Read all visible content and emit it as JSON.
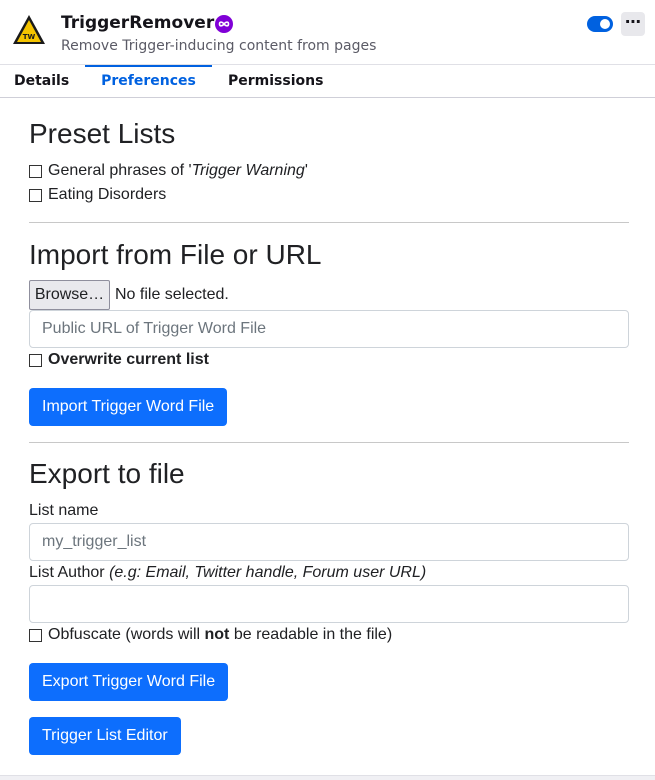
{
  "header": {
    "title": "TriggerRemover",
    "subtitle": "Remove Trigger-inducing content from pages",
    "logo_text": "TW",
    "more_label": "⋯"
  },
  "tabs": [
    {
      "label": "Details"
    },
    {
      "label": "Preferences"
    },
    {
      "label": "Permissions"
    }
  ],
  "preset": {
    "heading": "Preset Lists",
    "general_prefix": "General phrases of '",
    "general_italic": "Trigger Warning",
    "general_suffix": "'",
    "eating": "Eating Disorders"
  },
  "import": {
    "heading": "Import from File or URL",
    "browse_label": "Browse…",
    "no_file": "No file selected.",
    "url_placeholder": "Public URL of Trigger Word File",
    "overwrite_label": "Overwrite current list",
    "button_label": "Import Trigger Word File"
  },
  "export": {
    "heading": "Export to file",
    "list_name_label": "List name",
    "list_name_placeholder": "my_trigger_list",
    "author_label": "List Author",
    "author_hint": "(e.g: Email, Twitter handle, Forum user URL)",
    "obfuscate_prefix": "Obfuscate (words will ",
    "obfuscate_bold": "not",
    "obfuscate_suffix": " be readable in the file)",
    "export_button": "Export Trigger Word File",
    "editor_button": "Trigger List Editor"
  },
  "colors": {
    "accent": "#0061e0",
    "primary_button": "#0d6efd",
    "logo_yellow": "#f5c400",
    "badge_purple": "#8000d7"
  },
  "toggle": {
    "enabled": true
  }
}
